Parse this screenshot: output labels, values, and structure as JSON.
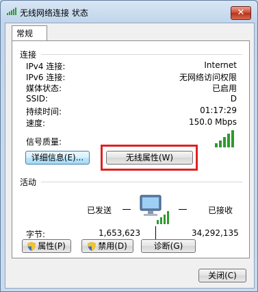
{
  "window": {
    "title": "无线网络连接 状态",
    "close_label": "✕"
  },
  "tabs": [
    {
      "label": "常规"
    }
  ],
  "connection": {
    "section_label": "连接",
    "rows": [
      {
        "label": "IPv4 连接:",
        "value": "Internet"
      },
      {
        "label": "IPv6 连接:",
        "value": "无网络访问权限"
      },
      {
        "label": "媒体状态:",
        "value": "已启用"
      },
      {
        "label": "SSID:",
        "value": "D"
      },
      {
        "label": "持续时间:",
        "value": "01:17:29"
      },
      {
        "label": "速度:",
        "value": "150.0 Mbps"
      }
    ],
    "signal_label": "信号质量:",
    "signal_bars": 5
  },
  "buttons": {
    "details": "详细信息(E)...",
    "wireless_props": "无线属性(W)",
    "properties": "属性(P)",
    "disable": "禁用(D)",
    "diagnose": "诊断(G)",
    "close": "关闭(C)"
  },
  "activity": {
    "section_label": "活动",
    "sent_label": "已发送",
    "received_label": "已接收",
    "bytes_label": "字节:",
    "bytes_sent": "1,653,623",
    "bytes_received": "34,292,135"
  },
  "colors": {
    "highlight": "#e02020",
    "signal": "#2e9a2e"
  }
}
